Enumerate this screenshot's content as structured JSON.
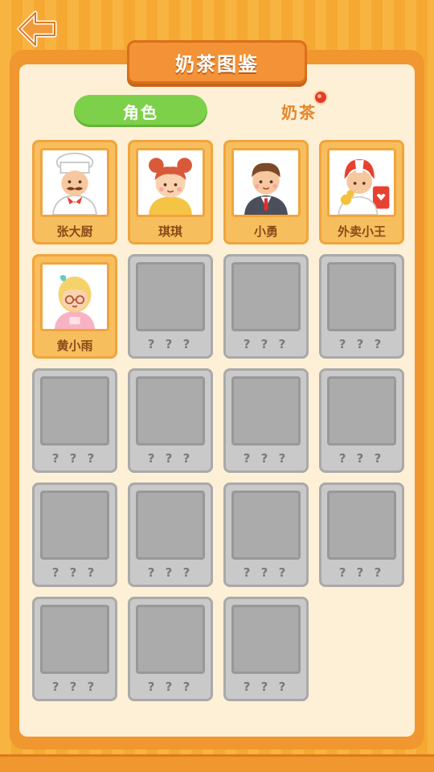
{
  "header": {
    "title": "奶茶图鉴"
  },
  "tabs": {
    "role_label": "角色",
    "tea_label": "奶茶"
  },
  "cards": [
    {
      "name": "张大厨",
      "unlocked": true,
      "portrait": "chef"
    },
    {
      "name": "琪琪",
      "unlocked": true,
      "portrait": "girl-buns"
    },
    {
      "name": "小勇",
      "unlocked": true,
      "portrait": "boy-suit"
    },
    {
      "name": "外卖小王",
      "unlocked": true,
      "portrait": "delivery"
    },
    {
      "name": "黄小雨",
      "unlocked": true,
      "portrait": "girl-glasses"
    },
    {
      "name": "? ? ?",
      "unlocked": false
    },
    {
      "name": "? ? ?",
      "unlocked": false
    },
    {
      "name": "? ? ?",
      "unlocked": false
    },
    {
      "name": "? ? ?",
      "unlocked": false
    },
    {
      "name": "? ? ?",
      "unlocked": false
    },
    {
      "name": "? ? ?",
      "unlocked": false
    },
    {
      "name": "? ? ?",
      "unlocked": false
    },
    {
      "name": "? ? ?",
      "unlocked": false
    },
    {
      "name": "? ? ?",
      "unlocked": false
    },
    {
      "name": "? ? ?",
      "unlocked": false
    },
    {
      "name": "? ? ?",
      "unlocked": false
    },
    {
      "name": "? ? ?",
      "unlocked": false
    },
    {
      "name": "? ? ?",
      "unlocked": false
    },
    {
      "name": "? ? ?",
      "unlocked": false
    }
  ],
  "colors": {
    "accent_orange": "#f39236",
    "tab_green": "#7dd14a",
    "panel_cream": "#fdf0d6",
    "locked_gray": "#c9c9c9",
    "badge_red": "#e33b2a"
  }
}
